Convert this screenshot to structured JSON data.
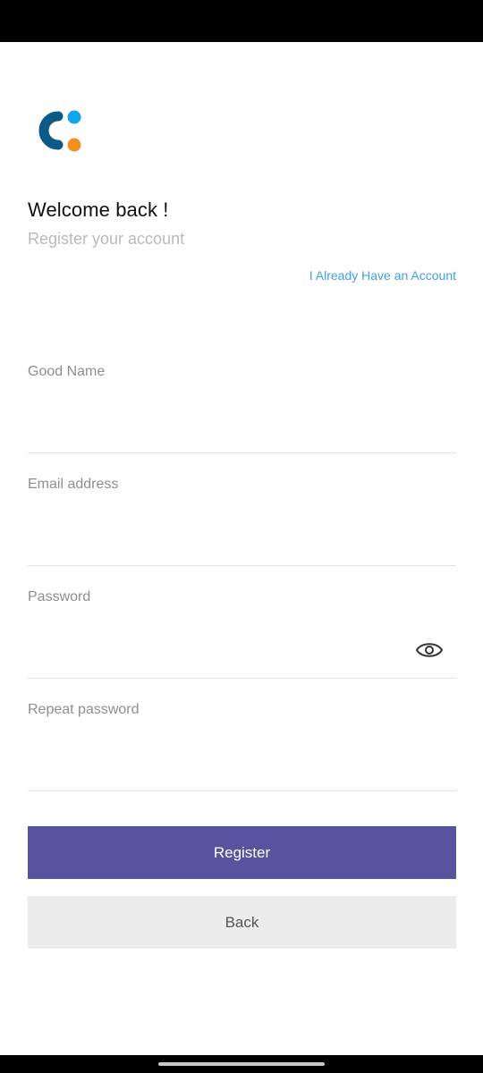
{
  "header": {
    "welcome": "Welcome back !",
    "subtitle": "Register your account",
    "login_link": "I Already Have an Account"
  },
  "logo": {
    "icon": "brand-logo-icon"
  },
  "form": {
    "name_label": "Good Name",
    "name_value": "",
    "email_label": "Email address",
    "email_value": "",
    "password_label": "Password",
    "password_value": "",
    "password_toggle_icon": "eye-icon",
    "repeat_password_label": "Repeat password",
    "repeat_password_value": ""
  },
  "actions": {
    "register_label": "Register",
    "back_label": "Back"
  },
  "colors": {
    "primary": "#57539e",
    "link": "#3f9fe6",
    "logo_dark": "#0d5a86",
    "logo_blue": "#14a4e8",
    "logo_orange": "#f39020",
    "secondary_button": "#ececec"
  }
}
